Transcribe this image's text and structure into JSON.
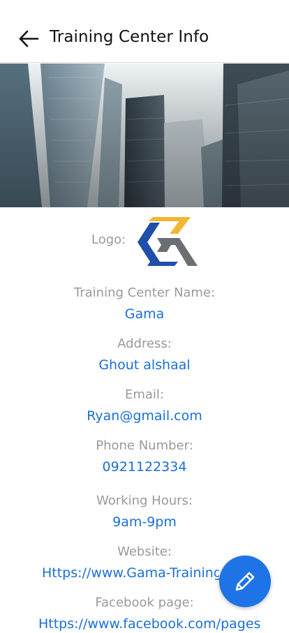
{
  "header": {
    "title": "Training Center Info"
  },
  "logo": {
    "label": "Logo:"
  },
  "fields": [
    {
      "label": "Training Center Name:",
      "value": "Gama"
    },
    {
      "label": "Address:",
      "value": "Ghout alshaal"
    },
    {
      "label": "Email:",
      "value": "Ryan@gmail.com"
    },
    {
      "label": "Phone Number:",
      "value": "0921122334"
    },
    {
      "label": "Working Hours:",
      "value": "9am-9pm"
    },
    {
      "label": "Website:",
      "value": "Https://www.Gama-Training."
    },
    {
      "label": "Facebook page:",
      "value": "Https://www.facebook.com/pages"
    }
  ],
  "colors": {
    "accent": "#1e73e6",
    "value_text": "#1a6fd6",
    "label_text": "#9a9a9a"
  },
  "icons": {
    "back": "arrow-left-icon",
    "edit": "pencil-icon"
  }
}
